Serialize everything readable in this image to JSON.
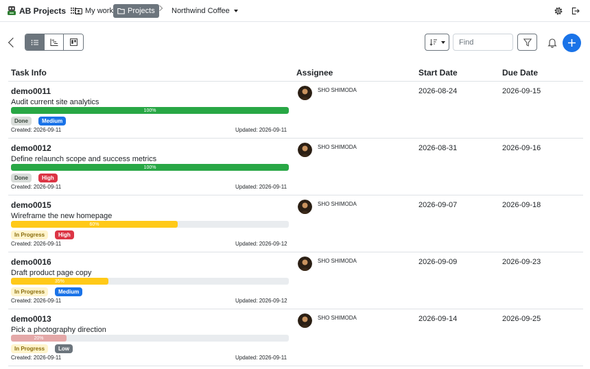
{
  "app": {
    "title": "AB Projects"
  },
  "nav": {
    "my_work": "My work",
    "projects": "Projects",
    "project_name": "Northwind Coffee"
  },
  "toolbar": {
    "search_placeholder": "Find"
  },
  "table": {
    "headers": {
      "task_info": "Task Info",
      "assignee": "Assignee",
      "start_date": "Start Date",
      "due_date": "Due Date"
    },
    "rows": [
      {
        "id": "demo0011",
        "title": "Audit current site analytics",
        "progress": 100,
        "progress_label": "100%",
        "progress_color": "#28a745",
        "status": "Done",
        "status_style": "done",
        "priority": "Medium",
        "priority_color": "#1a73e8",
        "created": "Created: 2026-09-11",
        "updated": "Updated: 2026-09-11",
        "assignee": "SHO SHIMODA",
        "start": "2026-08-24",
        "due": "2026-09-15"
      },
      {
        "id": "demo0012",
        "title": "Define relaunch scope and success metrics",
        "progress": 100,
        "progress_label": "100%",
        "progress_color": "#28a745",
        "status": "Done",
        "status_style": "done",
        "priority": "High",
        "priority_color": "#dc3545",
        "created": "Created: 2026-09-11",
        "updated": "Updated: 2026-09-11",
        "assignee": "SHO SHIMODA",
        "start": "2026-08-31",
        "due": "2026-09-16"
      },
      {
        "id": "demo0015",
        "title": "Wireframe the new homepage",
        "progress": 60,
        "progress_label": "60%",
        "progress_color": "#ffc918",
        "status": "In Progress",
        "status_style": "progress",
        "priority": "High",
        "priority_color": "#dc3545",
        "created": "Created: 2026-09-11",
        "updated": "Updated: 2026-09-12",
        "assignee": "SHO SHIMODA",
        "start": "2026-09-07",
        "due": "2026-09-18"
      },
      {
        "id": "demo0016",
        "title": "Draft product page copy",
        "progress": 35,
        "progress_label": "35%",
        "progress_color": "#ffc918",
        "status": "In Progress",
        "status_style": "progress",
        "priority": "Medium",
        "priority_color": "#1a73e8",
        "created": "Created: 2026-09-11",
        "updated": "Updated: 2026-09-12",
        "assignee": "SHO SHIMODA",
        "start": "2026-09-09",
        "due": "2026-09-23"
      },
      {
        "id": "demo0013",
        "title": "Pick a photography direction",
        "progress": 20,
        "progress_label": "20%",
        "progress_color": "#e4a8a8",
        "status": "In Progress",
        "status_style": "progress",
        "priority": "Low",
        "priority_color": "#6c757d",
        "created": "Created: 2026-09-11",
        "updated": "Updated: 2026-09-11",
        "assignee": "SHO SHIMODA",
        "start": "2026-09-14",
        "due": "2026-09-25"
      }
    ]
  }
}
